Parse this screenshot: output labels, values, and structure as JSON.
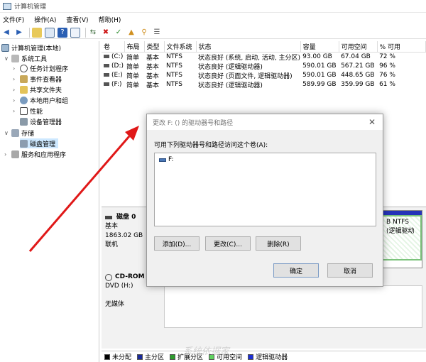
{
  "window": {
    "title": "计算机管理"
  },
  "menu": [
    "文件(F)",
    "操作(A)",
    "查看(V)",
    "帮助(H)"
  ],
  "toolbar": {
    "icons": [
      "back-icon",
      "forward-icon",
      "up-folder-icon",
      "console-tree-icon",
      "help-icon",
      "properties-icon",
      "connect-icon",
      "delete-icon",
      "check-icon",
      "export-icon",
      "search-icon",
      "list-icon"
    ],
    "colors": {
      "delete": "#cc1111",
      "help": "#2b5fb3"
    }
  },
  "tree": {
    "root": "计算机管理(本地)",
    "system_tools": "系统工具",
    "task_scheduler": "任务计划程序",
    "event_viewer": "事件查看器",
    "shared_folders": "共享文件夹",
    "local_users": "本地用户和组",
    "performance": "性能",
    "device_manager": "设备管理器",
    "storage": "存储",
    "disk_management": "磁盘管理",
    "services": "服务和应用程序"
  },
  "volumes": {
    "headers": [
      "卷",
      "布局",
      "类型",
      "文件系统",
      "状态",
      "容量",
      "可用空间",
      "% 可用"
    ],
    "rows": [
      {
        "vol": "(C:)",
        "layout": "简单",
        "type": "基本",
        "fs": "NTFS",
        "status": "状态良好 (系统, 启动, 活动, 主分区)",
        "capacity": "93.00 GB",
        "free": "67.04 GB",
        "pct": "72 %"
      },
      {
        "vol": "(D:)",
        "layout": "简单",
        "type": "基本",
        "fs": "NTFS",
        "status": "状态良好 (逻辑驱动器)",
        "capacity": "590.01 GB",
        "free": "567.21 GB",
        "pct": "96 %"
      },
      {
        "vol": "(E:)",
        "layout": "简单",
        "type": "基本",
        "fs": "NTFS",
        "status": "状态良好 (页面文件, 逻辑驱动器)",
        "capacity": "590.01 GB",
        "free": "448.65 GB",
        "pct": "76 %"
      },
      {
        "vol": "(F:)",
        "layout": "简单",
        "type": "基本",
        "fs": "NTFS",
        "status": "状态良好 (逻辑驱动器)",
        "capacity": "589.99 GB",
        "free": "359.99 GB",
        "pct": "61 %"
      }
    ]
  },
  "disk0": {
    "name": "磁盘 0",
    "type": "基本",
    "size": "1863.02 GB",
    "state": "联机",
    "partition_line1": "B NTFS",
    "partition_line2": "(逻辑驱动"
  },
  "cdrom": {
    "name": "CD-ROM",
    "drive": "DVD (H:)",
    "media": "无媒体"
  },
  "legend": [
    {
      "label": "未分配",
      "color": "#000000"
    },
    {
      "label": "主分区",
      "color": "#1a2a9c"
    },
    {
      "label": "扩展分区",
      "color": "#2d9c2d"
    },
    {
      "label": "可用空间",
      "color": "#5fd35f"
    },
    {
      "label": "逻辑驱动器",
      "color": "#1c2fd6"
    }
  ],
  "dialog": {
    "title": "更改 F: () 的驱动器号和路径",
    "label": "可用下列驱动器号和路径访问这个卷(A):",
    "list_item": "F:",
    "add": "添加(D)...",
    "change": "更改(C)...",
    "remove": "删除(R)",
    "ok": "确定",
    "cancel": "取消"
  },
  "watermark": "系统依据家"
}
